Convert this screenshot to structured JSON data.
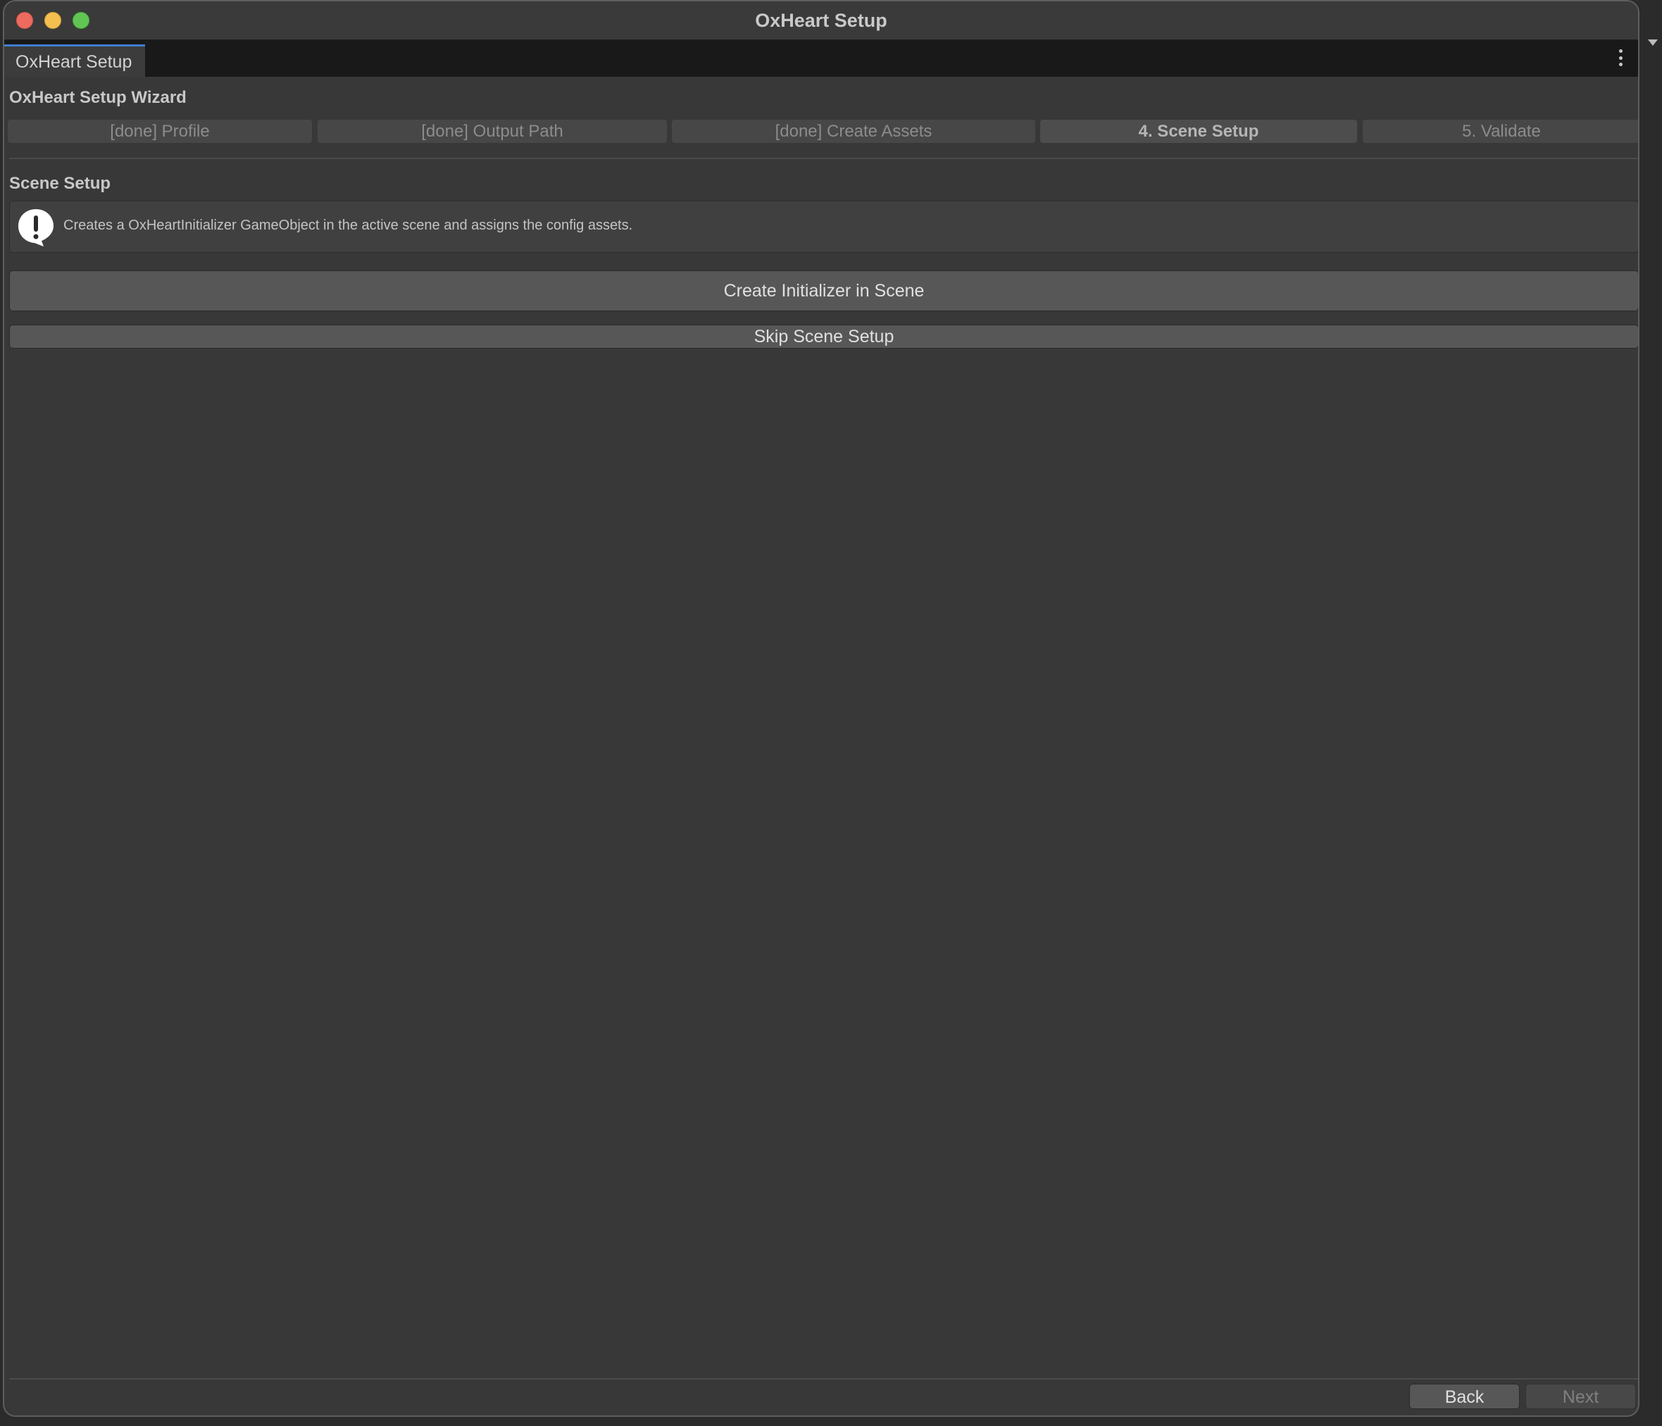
{
  "window": {
    "title": "OxHeart Setup"
  },
  "tabs": [
    {
      "label": "OxHeart Setup"
    }
  ],
  "wizard": {
    "title": "OxHeart Setup Wizard",
    "steps": [
      {
        "label": "[done] Profile",
        "state": "done"
      },
      {
        "label": "[done] Output Path",
        "state": "done"
      },
      {
        "label": "[done] Create Assets",
        "state": "done"
      },
      {
        "label": "4. Scene Setup",
        "state": "active"
      },
      {
        "label": "5. Validate",
        "state": "pending"
      }
    ]
  },
  "section": {
    "title": "Scene Setup",
    "help_text": "Creates a OxHeartInitializer GameObject in the active scene and assigns the config assets.",
    "help_icon": "info-exclamation-icon"
  },
  "actions": {
    "create_label": "Create Initializer in Scene",
    "skip_label": "Skip Scene Setup"
  },
  "footer": {
    "back_label": "Back",
    "next_label": "Next",
    "next_enabled": false
  }
}
